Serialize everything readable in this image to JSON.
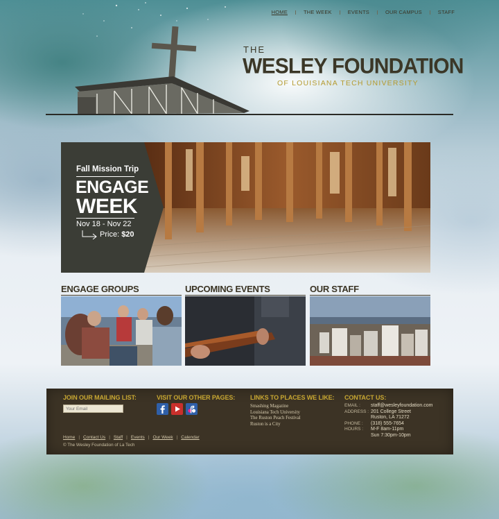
{
  "nav": {
    "items": [
      {
        "label": "HOME"
      },
      {
        "label": "THE WEEK"
      },
      {
        "label": "EVENTS"
      },
      {
        "label": "OUR CAMPUS"
      },
      {
        "label": "STAFF"
      }
    ]
  },
  "logo": {
    "the": "THE",
    "main": "WESLEY FOUNDATION",
    "sub": "of Louisiana Tech University"
  },
  "banner": {
    "kicker": "Fall Mission Trip",
    "title_line1": "ENGAGE",
    "title_line2": "WEEK",
    "dates": "Nov 18 - Nov 22",
    "price_label": "Price:",
    "price_value": "$20"
  },
  "sections": [
    {
      "title": "ENGAGE GROUPS"
    },
    {
      "title": "UPCOMING EVENTS"
    },
    {
      "title": "OUR STAFF"
    }
  ],
  "footer": {
    "mailing": {
      "heading": "JOIN OUR MAILING LIST:",
      "placeholder": "Your Email"
    },
    "social": {
      "heading": "VISIT OUR OTHER PAGES:",
      "icons": [
        "facebook-icon",
        "youtube-icon",
        "flickr-icon"
      ]
    },
    "links": {
      "heading": "LINKS TO PLACES WE LIKE:",
      "items": [
        "Smashing Magazine",
        "Louisiana Tech University",
        "The Ruston Peach Festival",
        "Ruston is a City"
      ]
    },
    "contact": {
      "heading": "CONTACT US:",
      "email_label": "EMAIL :",
      "email": "staff@wesleyfoundation.com",
      "address_label": "ADDRESS :",
      "address1": "201 College Street",
      "address2": "Ruston, LA 71272",
      "phone_label": "PHONE :",
      "phone": "(318) 555-7654",
      "hours_label": "HOURS :",
      "hours1": "M-F 8am-11pm",
      "hours2": "Sun 7:30pm-10pm"
    },
    "nav": [
      "Home",
      "Contact Us",
      "Staff",
      "Events",
      "Our Week",
      "Calendar"
    ],
    "copyright": "© The Wesley Foundation of La Tech"
  },
  "colors": {
    "accent": "#c8a732",
    "dark": "#3b3727",
    "footer_bg": "#3c3325",
    "banner_panel": "#3b3d36"
  }
}
